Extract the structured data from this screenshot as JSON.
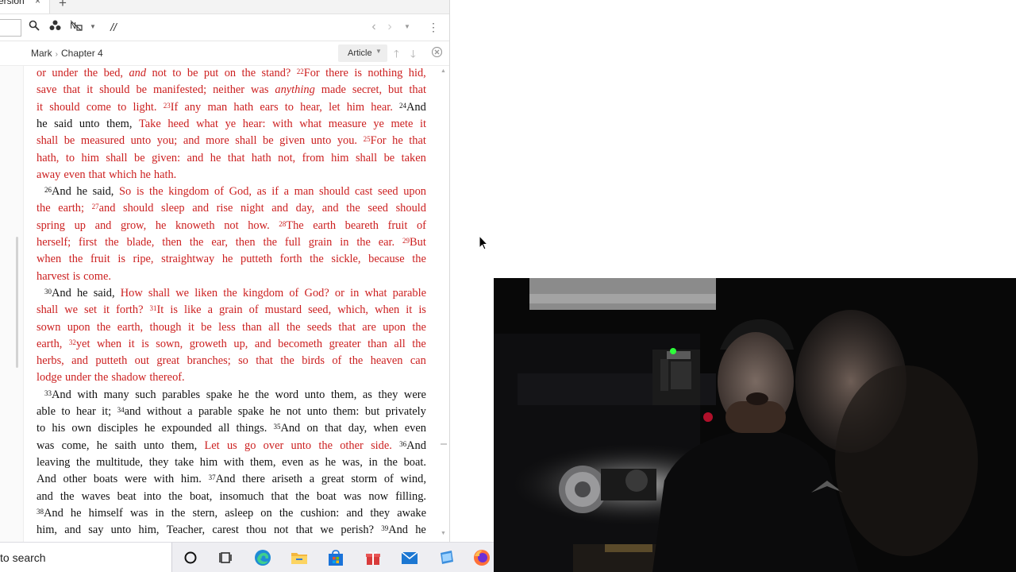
{
  "tab": {
    "title": "ersion",
    "close": "×",
    "new_tab": "+"
  },
  "toolbar": {
    "separator_label": "//"
  },
  "breadcrumb": {
    "book": "Mark",
    "sep": "›",
    "chapter": "Chapter 4"
  },
  "article_button": {
    "label": "Article",
    "caret": "▼"
  },
  "lines": [
    [
      [
        "r",
        "or under the bed,"
      ],
      [
        "r",
        " "
      ],
      [
        "ri",
        "and"
      ],
      [
        "r",
        " not to be put on the stand?"
      ],
      [
        "v",
        "22"
      ],
      [
        "r",
        "For there is nothing hid,"
      ]
    ],
    [
      [
        "r",
        "save that it should be manifested; neither was "
      ],
      [
        "ri",
        "anything"
      ],
      [
        "r",
        " made secret, but that"
      ]
    ],
    [
      [
        "r",
        "it should come to light. "
      ],
      [
        "v",
        "23"
      ],
      [
        "r",
        "If any man hath ears to hear, let him hear. "
      ],
      [
        "v",
        "24"
      ],
      [
        "b",
        "And"
      ]
    ],
    [
      [
        "b",
        "he said unto them, "
      ],
      [
        "r",
        "Take heed what ye hear: with what measure ye mete it"
      ]
    ],
    [
      [
        "r",
        "shall be measured unto you; and more shall be given unto you. "
      ],
      [
        "v",
        "25"
      ],
      [
        "r",
        "For he that"
      ]
    ],
    [
      [
        "r",
        "hath, to him shall be given: and he that hath not, from him shall be taken"
      ]
    ],
    [
      [
        "r",
        "away even that which he hath."
      ]
    ],
    [
      [
        "v",
        "26"
      ],
      [
        "b",
        "And he said, "
      ],
      [
        "r",
        "So is the kingdom of God, as if a man should cast seed upon"
      ]
    ],
    [
      [
        "r",
        "the earth; "
      ],
      [
        "v",
        "27"
      ],
      [
        "r",
        "and should sleep and rise night and day, and the seed should"
      ]
    ],
    [
      [
        "r",
        "spring up and grow, he knoweth not how. "
      ],
      [
        "v",
        "28"
      ],
      [
        "r",
        "The earth beareth fruit of"
      ]
    ],
    [
      [
        "r",
        "herself; first the blade, then the ear, then the full grain in the ear. "
      ],
      [
        "v",
        "29"
      ],
      [
        "r",
        "But"
      ]
    ],
    [
      [
        "r",
        "when the fruit is ripe, straightway he putteth forth the sickle, because the"
      ]
    ],
    [
      [
        "r",
        "harvest is come."
      ]
    ],
    [
      [
        "v",
        "30"
      ],
      [
        "b",
        "And he said, "
      ],
      [
        "r",
        "How shall we liken the kingdom of God? or in what parable"
      ]
    ],
    [
      [
        "r",
        "shall we set it forth? "
      ],
      [
        "v",
        "31"
      ],
      [
        "r",
        "It is like a grain of mustard seed, which, when it is"
      ]
    ],
    [
      [
        "r",
        "sown upon the earth, though it be less than all the seeds that are upon the"
      ]
    ],
    [
      [
        "r",
        "earth, "
      ],
      [
        "v",
        "32"
      ],
      [
        "r",
        "yet when it is sown, groweth up, and becometh greater than all the"
      ]
    ],
    [
      [
        "r",
        "herbs, and putteth out great branches; so that the birds of the heaven can"
      ]
    ],
    [
      [
        "r",
        "lodge under the shadow thereof."
      ]
    ],
    [
      [
        "v",
        "33"
      ],
      [
        "b",
        "And with many such parables spake he the word unto them, as they were"
      ]
    ],
    [
      [
        "b",
        "able to hear it; "
      ],
      [
        "v",
        "34"
      ],
      [
        "b",
        "and without a parable spake he not unto them: but privately"
      ]
    ],
    [
      [
        "b",
        "to his own disciples he expounded all things. "
      ],
      [
        "v",
        "35"
      ],
      [
        "b",
        "And on that day, when even"
      ]
    ],
    [
      [
        "b",
        "was come, he saith unto them, "
      ],
      [
        "r",
        "Let us go over unto the other side. "
      ],
      [
        "v",
        "36"
      ],
      [
        "b",
        "And"
      ]
    ],
    [
      [
        "b",
        "leaving the multitude, they take him with them, even as he was, in the boat."
      ]
    ],
    [
      [
        "b",
        "And other boats were with him. "
      ],
      [
        "v",
        "37"
      ],
      [
        "b",
        "And there ariseth a great storm of wind,"
      ]
    ],
    [
      [
        "b",
        "and the waves beat into the boat, insomuch that the boat was now filling."
      ]
    ],
    [
      [
        "v",
        "38"
      ],
      [
        "b",
        "And he himself was in the stern, asleep on the cushion: and they awake"
      ]
    ],
    [
      [
        "b",
        "him, and say unto him, Teacher, carest thou not that we perish? "
      ],
      [
        "v",
        "39"
      ],
      [
        "b",
        "And he"
      ]
    ]
  ],
  "taskbar": {
    "search_text": "to search"
  },
  "colors": {
    "words_of_christ": "#cc1f1f",
    "body_text": "#111111"
  }
}
